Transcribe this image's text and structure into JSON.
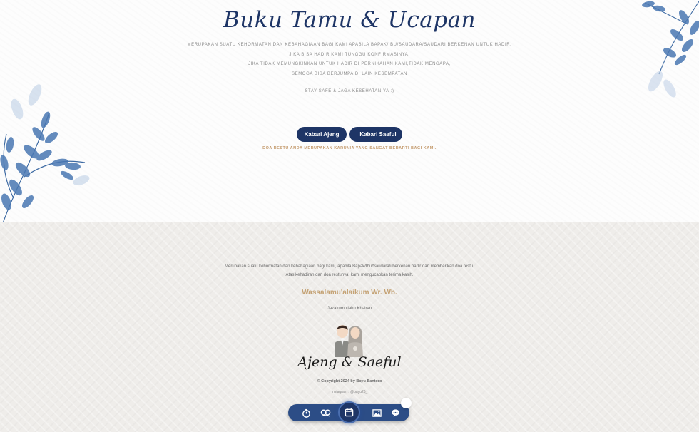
{
  "guestbook": {
    "title": "Buku Tamu & Ucapan",
    "intro_lines": [
      "MERUPAKAN SUATU KEHORMATAN DAN KEBAHAGIAAN BAGI KAMI APABILA BAPAK/IBU/SAUDARA/SAUDARI BERKENAN UNTUK HADIR.",
      "JIKA BISA HADIR KAMI TUNGGU KONFIRMASINYA,",
      "JIKA TIDAK MEMUNGKINKAN UNTUK HADIR DI PERNIKAHAN KAMI,TIDAK MENGAPA,",
      "SEMOGA BISA BERJUMPA DI LAIN KESEMPATAN"
    ],
    "stay_safe": "STAY SAFE & JAGA KESEHATAN YA :)",
    "button_ajeng": "Kabari Ajeng",
    "button_saeful": "Kabari Saeful",
    "doa_text": "DOA RESTU ANDA MERUPAKAN KARUNIA YANG SANGAT BERARTI BAGI KAMI."
  },
  "footer": {
    "closing_lines": [
      "Merupakan suatu kehormatan dan kebahagiaan bagi kami, apabila Bapak/Ibu/Saudara/i berkenan hadir dan memberikan doa restu.",
      "Atas kehadiran dan doa restunya, kami mengucapkan terima kasih."
    ],
    "salam": "Wassalamu'alaikum Wr. Wb.",
    "thanks": "Jazakumullahu Khairan",
    "couple_names": "Ajeng & Saeful",
    "copyright": "© Copyright 2024 by Bayu Bantoro",
    "instagram": "Instagram : @bayu26_"
  },
  "navbar": {
    "items": [
      "timer-icon",
      "couple-icon",
      "calendar-icon",
      "gallery-icon",
      "chat-icon"
    ]
  },
  "colors": {
    "navy": "#1e3566",
    "gold": "#c4a274",
    "leaf_blue": "#4a78b3"
  }
}
